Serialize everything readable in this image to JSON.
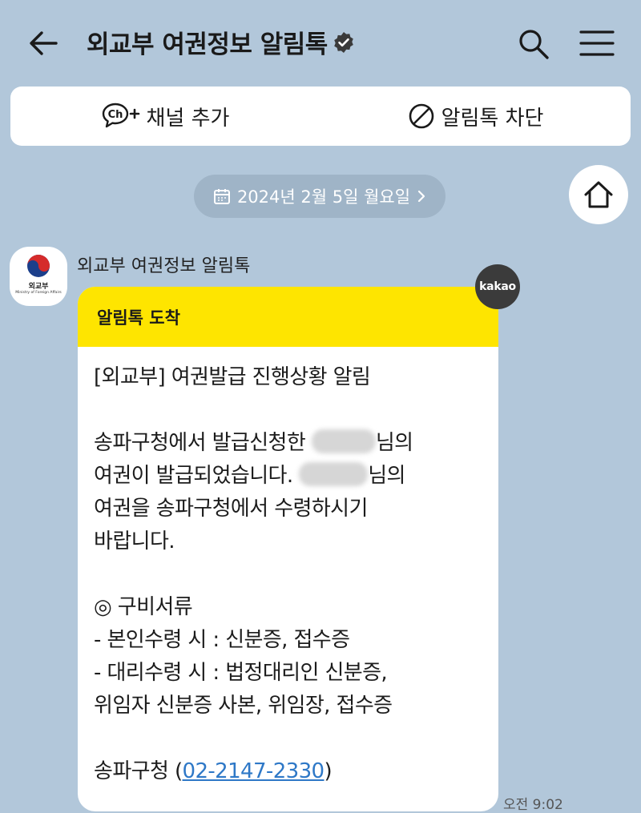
{
  "header": {
    "title": "외교부 여권정보 알림톡",
    "icons": {
      "back": "arrow-left-icon",
      "verified": "verified-check-icon",
      "search": "search-icon",
      "menu": "hamburger-menu-icon"
    }
  },
  "actions": {
    "add_channel": {
      "icon_text": "Ch",
      "label": "채널 추가"
    },
    "block": {
      "label": "알림톡 차단"
    }
  },
  "date_pill": {
    "label": "2024년 2월 5일 월요일"
  },
  "sender": {
    "name": "외교부 여권정보 알림톡",
    "avatar_name": "외교부",
    "avatar_sub": "Ministry of Foreign Affairs"
  },
  "message": {
    "header": "알림톡 도착",
    "l1": "[외교부] 여권발급 진행상황 알림",
    "l2a": "송파구청에서 발급신청한 ",
    "l2b": "님의",
    "l3a": "여권이 발급되었습니다. ",
    "l3b": "님의",
    "l4": "여권을 송파구청에서 수령하시기",
    "l5": "바랍니다.",
    "docs_title": "◎ 구비서류",
    "docs1": " - 본인수령 시 : 신분증, 접수증",
    "docs2": " - 대리수령 시 : 법정대리인 신분증,",
    "docs3": "위임자 신분증 사본, 위임장, 접수증",
    "contact_label": "송파구청 (",
    "phone": "02-2147-2330",
    "contact_end": ")"
  },
  "kakao_badge": "kakao",
  "time": "오전 9:02",
  "colors": {
    "background": "#b2c7da",
    "header_yellow": "#fee500",
    "link": "#2e78c7"
  }
}
